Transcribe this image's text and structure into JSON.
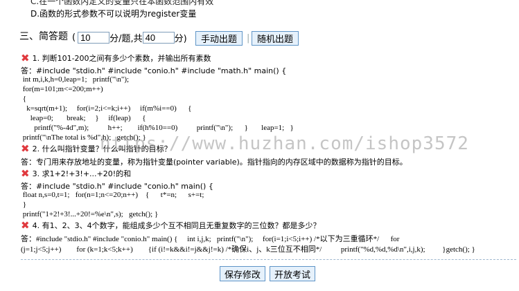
{
  "cut_option": "C.在一个函数内定义的变量只在本函数范围内有效",
  "cut_option_d": "D.函数的形式参数不可以说明为register变量",
  "section": {
    "title": "三、简答题",
    "open_paren": "(",
    "score_value": "10",
    "per_label": "分/题,共",
    "total_value": "40",
    "close_label": "分)",
    "manual_btn": "手动出题",
    "separator": "|",
    "random_btn": "随机出题"
  },
  "questions": [
    {
      "title": "1. 判断101-200之间有多少个素数，并输出所有素数",
      "answer_lines": [
        "答：#include \"stdio.h\" #include \"conio.h\" #include \"math.h\" main() {",
        " int m,i,k,h=0,leap=1;   printf(\"\\n\");",
        " for(m=101;m<=200;m++)",
        " {",
        "   k=sqrt(m+1);     for(i=2;i<=k;i++)     if(m%i==0)      {",
        "     leap=0;       break;     }     if(leap)      {",
        "       printf(\"%-4d\",m);          h++;        if(h%10==0)          printf(\"\\n\");      }       leap=1;   }",
        " printf(\"\\nThe total is %d\",h);   getch(); }"
      ]
    },
    {
      "title": "2. 什么叫指针变量？什么叫指针的目标？",
      "answer_lines": [
        "答：专门用来存放地址的变量，称为指针变量(pointer variable)。指针指向的内存区域中的数据称为指针的目标。"
      ]
    },
    {
      "title": "3. 求1+2!+3!+...+20!的和",
      "answer_lines": [
        "答：#include \"stdio.h\" #include \"conio.h\" main() {",
        " float n,s=0,t=1;   for(n=1;n<=20;n++)    {      t*=n;      s+=t;",
        " }",
        " printf(\"1+2!+3!...+20!=%e\\n\",s);   getch(); }"
      ]
    },
    {
      "title": "4. 有1、2、3、4个数字，能组成多少个互不相同且无重复数字的三位数？都是多少？",
      "answer_lines": [
        "答：#include \"stdio.h\" #include \"conio.h\" main() {     int i,j,k;   printf(\"\\n\");     for(i=1;i<5;i++) /*以下为三重循环*/      for",
        "(j=1;j<5;j++)        for (k=1;k<5;k++)        {if (i!=k&&i!=j&&j!=k) /*确保i、j、k三位互不相同*/          printf(\"%d,%d,%d\\n\",i,j,k);         }getch(); }"
      ]
    }
  ],
  "footer": {
    "save_btn": "保存修改",
    "open_btn": "开放考试"
  },
  "watermark": "https://www.huzhan.com/ishop3572",
  "colors": {
    "error_icon": "#e0393e",
    "button_bg": "#e6f1fb",
    "button_border": "#5e94c7"
  },
  "icons": {
    "wrong": "cross-icon"
  }
}
